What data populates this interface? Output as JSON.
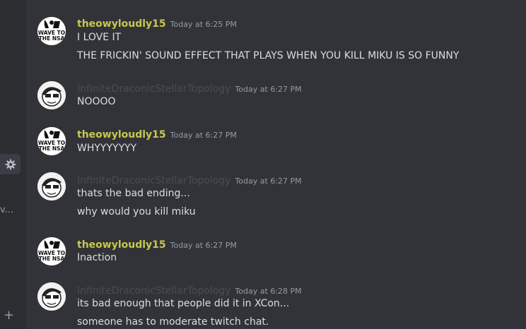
{
  "sidebar": {
    "gear_icon": "gear-icon",
    "truncated_text": "v...",
    "add_glyph": "+"
  },
  "messages": [
    {
      "author": "theowyloudly15",
      "time": "Today at 6:25 PM",
      "lines": [
        "I LOVE IT",
        "THE FRICKIN' SOUND EFFECT THAT PLAYS WHEN YOU KILL MIKU IS SO FUNNY"
      ],
      "avatar_text": [
        "WAVE TO",
        "THE NSA"
      ]
    },
    {
      "author": "InfiniteDraconicStellarTopology",
      "time": "Today at 6:27 PM",
      "lines": [
        "NOOOO"
      ]
    },
    {
      "author": "theowyloudly15",
      "time": "Today at 6:27 PM",
      "lines": [
        "WHYYYYYYY"
      ],
      "avatar_text": [
        "WAVE TO",
        "THE NSA"
      ]
    },
    {
      "author": "InfiniteDraconicStellarTopology",
      "time": "Today at 6:27 PM",
      "lines": [
        "thats the bad ending...",
        "why would you kill miku"
      ]
    },
    {
      "author": "theowyloudly15",
      "time": "Today at 6:27 PM",
      "lines": [
        "Inaction"
      ],
      "avatar_text": [
        "WAVE TO",
        "THE NSA"
      ]
    },
    {
      "author": "InfiniteDraconicStellarTopology",
      "time": "Today at 6:28 PM",
      "lines": [
        "its bad enough that people did it in XCon...",
        "someone has to moderate twitch chat."
      ]
    }
  ],
  "colors": {
    "background": "#313338",
    "sidebar": "#2b2d31",
    "author_owl": "#c8c84c",
    "author_inf": "#4a4c52",
    "text": "#dbdee1",
    "timestamp": "#949ba4"
  }
}
